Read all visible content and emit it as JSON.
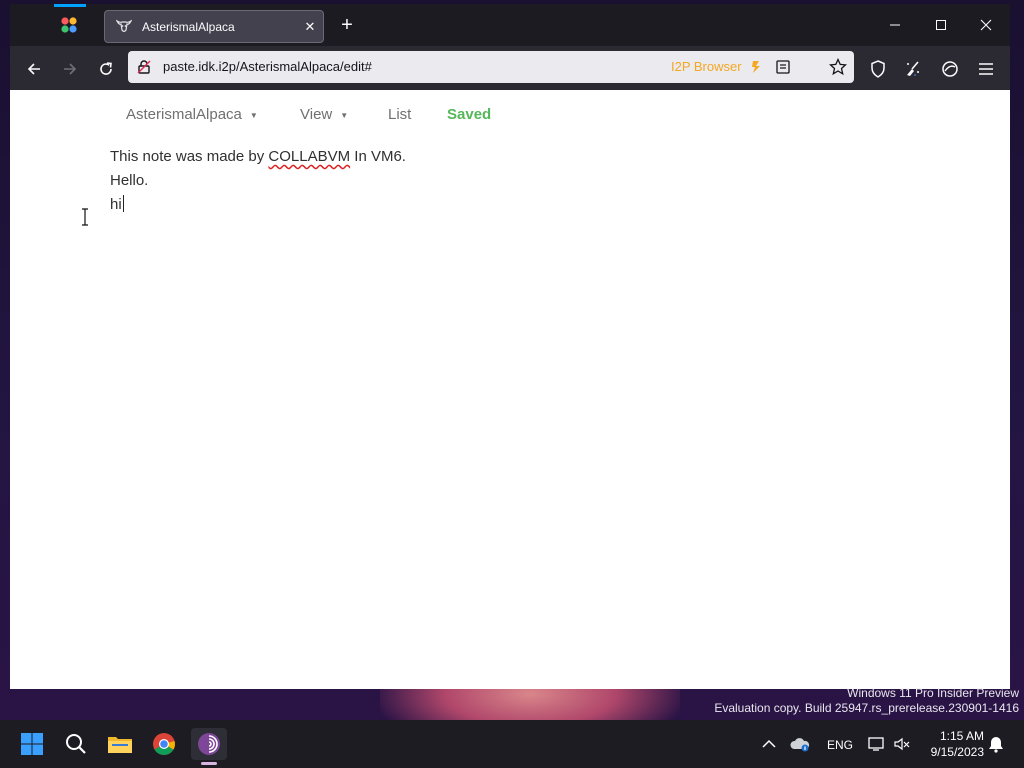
{
  "browser": {
    "tab_title": "AsterismalAlpaca",
    "tab_close": "✕",
    "new_tab": "+",
    "url": "paste.idk.i2p/AsterismalAlpaca/edit#",
    "i2p_label": "I2P Browser"
  },
  "note": {
    "menu_name": "AsterismalAlpaca",
    "menu_view": "View",
    "menu_list": "List",
    "status": "Saved",
    "line1_prefix": "This note was made by ",
    "line1_flagged": "COLLABVM",
    "line1_suffix": " In VM6.",
    "line2": "Hello.",
    "line3": "hi"
  },
  "desktop": {
    "watermark_line1": "Windows 11 Pro Insider Preview",
    "watermark_line2": "Evaluation copy. Build 25947.rs_prerelease.230901-1416"
  },
  "taskbar": {
    "language": "ENG",
    "time": "1:15 AM",
    "date": "9/15/2023"
  },
  "colors": {
    "saved_status": "#56b75a",
    "i2p_accent": "#f5a623",
    "tab_accent": "#00a2ff"
  }
}
